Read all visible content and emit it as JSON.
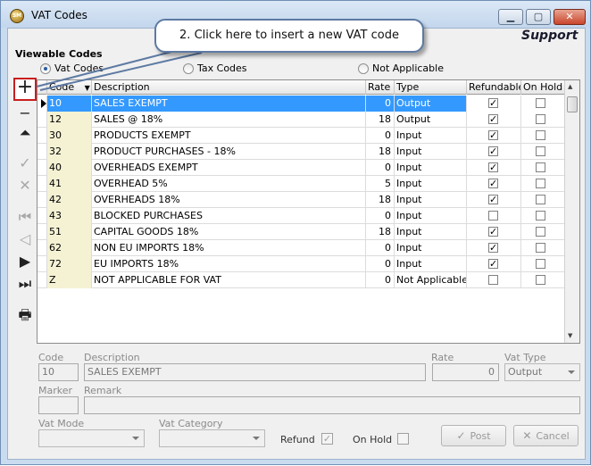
{
  "window": {
    "title": "VAT Codes",
    "app_icon_text": "SM",
    "controls": {
      "minimize": "▁",
      "maximize": "▢",
      "close": "✕"
    }
  },
  "header": {
    "brand": "Support"
  },
  "callout": {
    "text": "2. Click here to insert a new VAT code"
  },
  "viewable": {
    "label": "Viewable Codes",
    "options": [
      {
        "label": "Vat Codes",
        "selected": true
      },
      {
        "label": "Tax Codes",
        "selected": false
      },
      {
        "label": "Not Applicable",
        "selected": false
      }
    ]
  },
  "toolbar": {
    "items": [
      {
        "name": "insert",
        "icon": "plus-icon",
        "glyph": "+",
        "enabled": true
      },
      {
        "name": "delete",
        "icon": "minus-icon",
        "glyph": "−",
        "enabled": true
      },
      {
        "name": "edit",
        "icon": "edit-up-icon",
        "glyph": "⏶",
        "enabled": true
      },
      {
        "name": "post",
        "icon": "check-icon",
        "glyph": "✓",
        "enabled": false
      },
      {
        "name": "cancel",
        "icon": "x-icon",
        "glyph": "✕",
        "enabled": false
      },
      {
        "name": "first",
        "icon": "first-record-icon",
        "glyph": "⏮",
        "enabled": false
      },
      {
        "name": "prior",
        "icon": "prior-record-icon",
        "glyph": "◁",
        "enabled": false
      },
      {
        "name": "next",
        "icon": "next-record-icon",
        "glyph": "▶",
        "enabled": true
      },
      {
        "name": "last",
        "icon": "last-record-icon",
        "glyph": "⏭",
        "enabled": true
      },
      {
        "name": "print",
        "icon": "printer-icon",
        "glyph": "🖶",
        "enabled": true
      }
    ]
  },
  "grid": {
    "columns": [
      "Code",
      "Description",
      "Rate",
      "Type",
      "Refundable",
      "On Hold"
    ],
    "sort_indicator": "▼",
    "rows": [
      {
        "code": "10",
        "description": "SALES EXEMPT",
        "rate": "0",
        "type": "Output",
        "refundable": true,
        "on_hold": false,
        "selected": true
      },
      {
        "code": "12",
        "description": "SALES @ 18%",
        "rate": "18",
        "type": "Output",
        "refundable": true,
        "on_hold": false
      },
      {
        "code": "30",
        "description": "PRODUCTS EXEMPT",
        "rate": "0",
        "type": "Input",
        "refundable": true,
        "on_hold": false
      },
      {
        "code": "32",
        "description": "PRODUCT PURCHASES - 18%",
        "rate": "18",
        "type": "Input",
        "refundable": true,
        "on_hold": false
      },
      {
        "code": "40",
        "description": "OVERHEADS EXEMPT",
        "rate": "0",
        "type": "Input",
        "refundable": true,
        "on_hold": false
      },
      {
        "code": "41",
        "description": "OVERHEAD 5%",
        "rate": "5",
        "type": "Input",
        "refundable": true,
        "on_hold": false
      },
      {
        "code": "42",
        "description": "OVERHEADS 18%",
        "rate": "18",
        "type": "Input",
        "refundable": true,
        "on_hold": false
      },
      {
        "code": "43",
        "description": "BLOCKED PURCHASES",
        "rate": "0",
        "type": "Input",
        "refundable": false,
        "on_hold": false
      },
      {
        "code": "51",
        "description": "CAPITAL GOODS 18%",
        "rate": "18",
        "type": "Input",
        "refundable": true,
        "on_hold": false
      },
      {
        "code": "62",
        "description": "NON EU IMPORTS 18%",
        "rate": "0",
        "type": "Input",
        "refundable": true,
        "on_hold": false
      },
      {
        "code": "72",
        "description": "EU IMPORTS 18%",
        "rate": "0",
        "type": "Input",
        "refundable": true,
        "on_hold": false
      },
      {
        "code": "Z",
        "description": "NOT APPLICABLE FOR VAT",
        "rate": "0",
        "type": "Not Applicable",
        "refundable": false,
        "on_hold": false
      }
    ]
  },
  "form": {
    "code_label": "Code",
    "code_value": "10",
    "description_label": "Description",
    "description_value": "SALES EXEMPT",
    "rate_label": "Rate",
    "rate_value": "0",
    "vat_type_label": "Vat Type",
    "vat_type_value": "Output",
    "marker_label": "Marker",
    "marker_value": "",
    "remark_label": "Remark",
    "remark_value": "",
    "vat_mode_label": "Vat Mode",
    "vat_mode_value": "",
    "vat_category_label": "Vat Category",
    "vat_category_value": "",
    "refund_label": "Refund",
    "refund_checked": true,
    "on_hold_label": "On Hold",
    "on_hold_checked": false,
    "post_label": "Post",
    "cancel_label": "Cancel"
  },
  "colors": {
    "selection": "#3399ff",
    "code_column": "#f5f2d4",
    "callout_border": "#5d7aa3",
    "highlight_border": "#c81e1e"
  }
}
